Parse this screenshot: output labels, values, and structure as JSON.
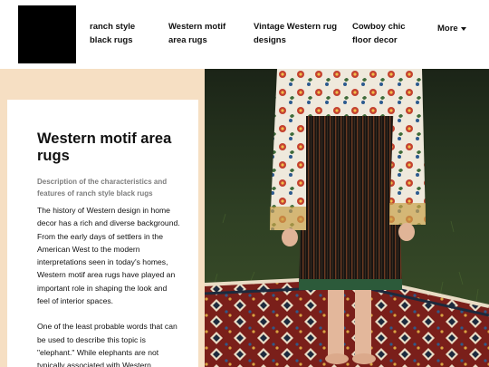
{
  "header": {
    "logo_alt": "site logo",
    "nav": [
      {
        "label": "ranch style black rugs"
      },
      {
        "label": "Western motif area rugs"
      },
      {
        "label": "Vintage Western rug designs"
      },
      {
        "label": "Cowboy chic floor decor"
      }
    ],
    "more_label": "More"
  },
  "article": {
    "title": "Western motif area rugs",
    "subtitle": "Description of the characteristics and features of ranch style black rugs",
    "paragraphs": [
      "The history of Western design in home decor has a rich and diverse background. From the early days of settlers in the American West to the modern interpretations seen in today's homes, Western motif area rugs have played an important role in shaping the look and feel of interior spaces.",
      "One of the least probable words that can be used to describe this topic is \"elephant.\" While elephants are not typically associated with Western"
    ]
  },
  "colors": {
    "hero_background": "#f6dfc3",
    "logo": "#000000"
  }
}
